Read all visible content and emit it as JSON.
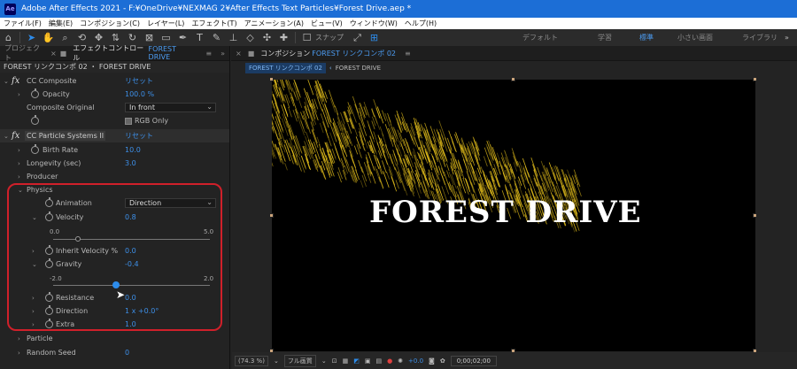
{
  "titlebar": {
    "logo": "Ae",
    "title": "Adobe After Effects 2021 - F:¥OneDrive¥NEXMAG 2¥After Effects Text Particles¥Forest Drive.aep *"
  },
  "menu": [
    "ファイル(F)",
    "編集(E)",
    "コンポジション(C)",
    "レイヤー(L)",
    "エフェクト(T)",
    "アニメーション(A)",
    "ビュー(V)",
    "ウィンドウ(W)",
    "ヘルプ(H)"
  ],
  "toolbar": {
    "snap_label": "スナップ"
  },
  "workspaces": {
    "default": "デフォルト",
    "learn": "学習",
    "standard": "標準",
    "small": "小さい画面",
    "library": "ライブラリ",
    "more": "»"
  },
  "left_panel": {
    "tab_project": "プロジェクト",
    "tab_effects_prefix": "エフェクトコントロール",
    "tab_effects_target": "FOREST DRIVE",
    "header": "FOREST リンクコンポ 02 ・ FOREST DRIVE",
    "cc_composite": {
      "name": "CC Composite",
      "reset": "リセット",
      "opacity_label": "Opacity",
      "opacity_value": "100.0 %",
      "original_label": "Composite Original",
      "original_value": "In front",
      "rgb_only": "RGB Only"
    },
    "cc_particle": {
      "name": "CC Particle Systems II",
      "reset": "リセット",
      "birth_rate_label": "Birth Rate",
      "birth_rate_value": "10.0",
      "longevity_label": "Longevity (sec)",
      "longevity_value": "3.0",
      "producer_label": "Producer",
      "physics_label": "Physics",
      "animation_label": "Animation",
      "animation_value": "Direction",
      "velocity_label": "Velocity",
      "velocity_value": "0.8",
      "velocity_min": "0.0",
      "velocity_max": "5.0",
      "velocity_fraction": 0.16,
      "inherit_label": "Inherit Velocity %",
      "inherit_value": "0.0",
      "gravity_label": "Gravity",
      "gravity_value": "-0.4",
      "gravity_min": "-2.0",
      "gravity_max": "2.0",
      "gravity_fraction": 0.4,
      "resistance_label": "Resistance",
      "resistance_value": "0.0",
      "direction_label": "Direction",
      "direction_value": "1 x +0.0°",
      "extra_label": "Extra",
      "extra_value": "1.0",
      "particle_label": "Particle",
      "random_seed_label": "Random Seed",
      "random_seed_value": "0"
    }
  },
  "right_panel": {
    "tab_label": "コンポジション",
    "tab_target": "FOREST リンクコンポ 02",
    "breadcrumb_1": "FOREST リンクコンポ 02",
    "breadcrumb_2": "FOREST DRIVE",
    "canvas_text": "FOREST DRIVE",
    "zoom": "(74.3 %)",
    "resolution": "フル画質",
    "exposure": "+0.0",
    "timecode": "0;00;02;00"
  },
  "colors": {
    "accent": "#2d8ceb",
    "value_blue": "#3d8fe8",
    "highlight_red": "#d0202a",
    "particles": "#e8c21c",
    "titlebar": "#1c6ed6"
  }
}
